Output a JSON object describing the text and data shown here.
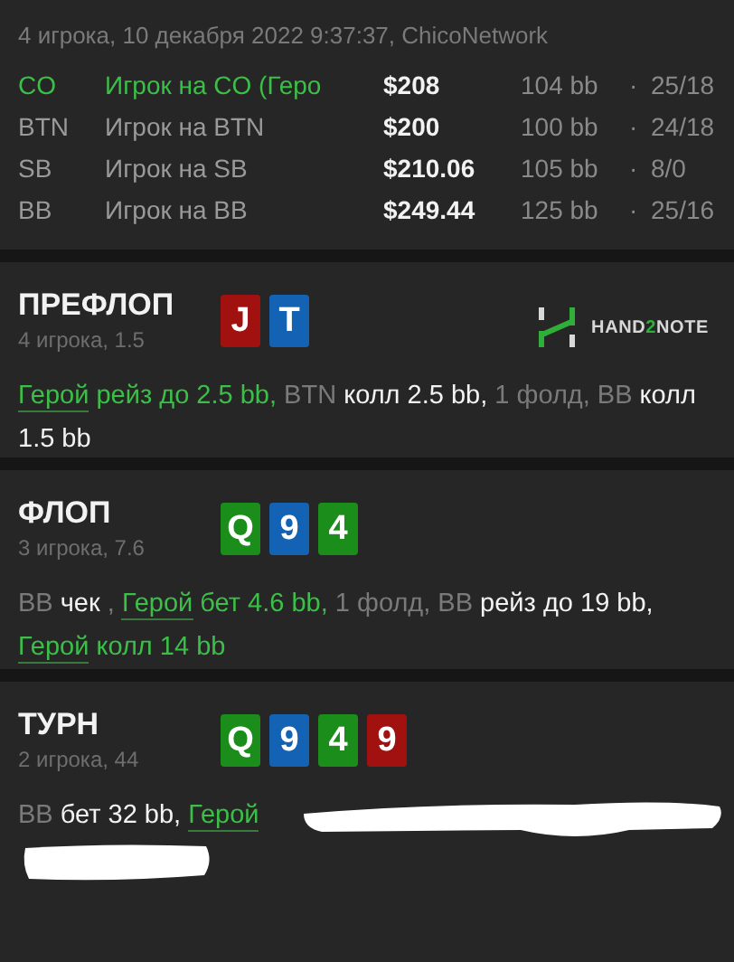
{
  "header": {
    "subtitle": "4 игрока, 10 декабря 2022 9:37:37, ChicoNetwork",
    "players": [
      {
        "position": "CO",
        "name": "Игрок на CO (Геро",
        "hero": true,
        "stack": "$208",
        "bb": "104 bb",
        "separator": "·",
        "stats": "25/18"
      },
      {
        "position": "BTN",
        "name": "Игрок на BTN",
        "hero": false,
        "stack": "$200",
        "bb": "100 bb",
        "separator": "·",
        "stats": "24/18"
      },
      {
        "position": "SB",
        "name": "Игрок на SB",
        "hero": false,
        "stack": "$210.06",
        "bb": "105 bb",
        "separator": "·",
        "stats": "8/0"
      },
      {
        "position": "BB",
        "name": "Игрок на BB",
        "hero": false,
        "stack": "$249.44",
        "bb": "125 bb",
        "separator": "·",
        "stats": "25/16"
      }
    ]
  },
  "streets": [
    {
      "name": "ПРЕФЛОП",
      "info": "4 игрока, 1.5",
      "logo": {
        "prefix": "HAND",
        "accent": "2",
        "suffix": "NOTE"
      },
      "redacted": false,
      "cards": [
        {
          "rank": "J",
          "color": "#a0110f"
        },
        {
          "rank": "T",
          "color": "#1462b4"
        }
      ],
      "actions": [
        {
          "text": "Герой",
          "kind": "hero-link"
        },
        {
          "text": " рейз до 2.5 bb,",
          "kind": "hero"
        },
        {
          "text": " BTN",
          "kind": "muted"
        },
        {
          "text": " колл 2.5 bb,",
          "kind": "action"
        },
        {
          "text": " 1 фолд, BB",
          "kind": "muted"
        },
        {
          "text": " колл 1.5 bb",
          "kind": "action"
        }
      ]
    },
    {
      "name": "ФЛОП",
      "info": "3 игрока, 7.6",
      "redacted": false,
      "cards": [
        {
          "rank": "Q",
          "color": "#1a8d1a"
        },
        {
          "rank": "9",
          "color": "#1462b4"
        },
        {
          "rank": "4",
          "color": "#1a8d1a"
        }
      ],
      "actions": [
        {
          "text": "BB",
          "kind": "muted"
        },
        {
          "text": " чек ",
          "kind": "action"
        },
        {
          "text": ", ",
          "kind": "muted"
        },
        {
          "text": "Герой",
          "kind": "hero-link"
        },
        {
          "text": " бет 4.6 bb,",
          "kind": "hero"
        },
        {
          "text": " 1 фолд, BB",
          "kind": "muted"
        },
        {
          "text": " рейз до 19 bb, ",
          "kind": "action"
        },
        {
          "text": "Герой",
          "kind": "hero-link"
        },
        {
          "text": " колл 14 bb",
          "kind": "hero"
        }
      ]
    },
    {
      "name": "ТУРН",
      "info": "2 игрока, 44",
      "redacted": true,
      "cards": [
        {
          "rank": "Q",
          "color": "#1a8d1a"
        },
        {
          "rank": "9",
          "color": "#1462b4"
        },
        {
          "rank": "4",
          "color": "#1a8d1a"
        },
        {
          "rank": "9",
          "color": "#a0110f"
        }
      ],
      "actions": [
        {
          "text": "BB",
          "kind": "muted"
        },
        {
          "text": " бет 32 bb, ",
          "kind": "action"
        },
        {
          "text": "Герой",
          "kind": "hero-link"
        }
      ]
    }
  ]
}
